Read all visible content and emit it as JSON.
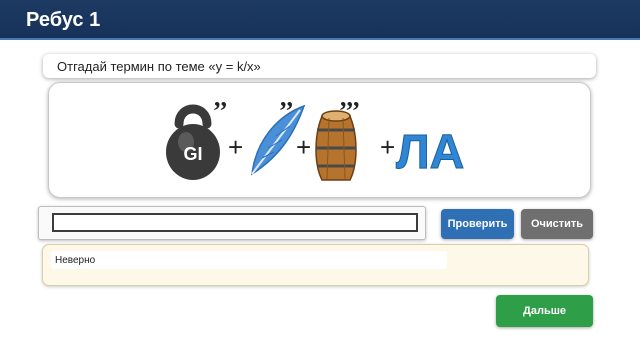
{
  "header": {
    "title": "Ребус 1"
  },
  "question": {
    "text": "Отгадай термин по теме «y = k/x»"
  },
  "rebus": {
    "weight_label": "GI",
    "ending_text": "ЛА",
    "plus": "+",
    "commas_1": ",,",
    "commas_2": ",,",
    "commas_3": ",,,",
    "colors": {
      "weight": "#3a3a3a",
      "feather": "#4a90d9",
      "barrel": "#b5732e",
      "ending": "#2f86d4"
    }
  },
  "answer": {
    "value": "",
    "placeholder": ""
  },
  "buttons": {
    "check_label": "Проверить",
    "clear_label": "Очистить",
    "next_label": "Дальше"
  },
  "feedback": {
    "text": "Неверно"
  },
  "theme": {
    "header_bg": "#1d3a63",
    "check": "#2f6fb3",
    "clear": "#6f6f6f",
    "next": "#2e9e48",
    "feedback_bg": "#fdf8e7"
  }
}
